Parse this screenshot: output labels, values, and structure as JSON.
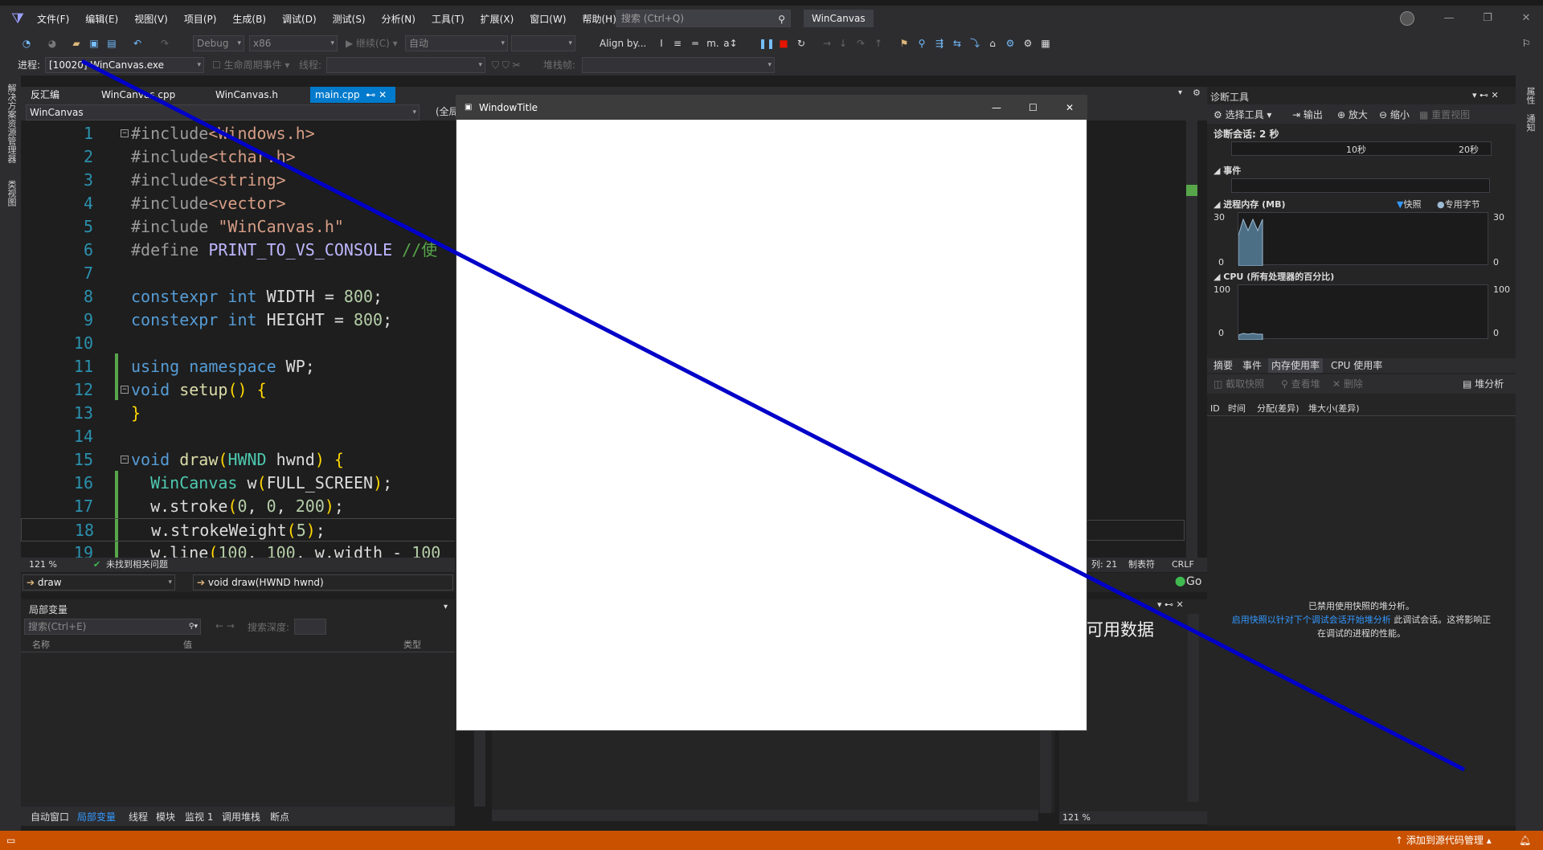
{
  "menubar": {
    "items": [
      "文件(F)",
      "编辑(E)",
      "视图(V)",
      "项目(P)",
      "生成(B)",
      "调试(D)",
      "测试(S)",
      "分析(N)",
      "工具(T)",
      "扩展(X)",
      "窗口(W)",
      "帮助(H)"
    ],
    "search_placeholder": "搜索 (Ctrl+Q)",
    "app_title": "WinCanvas"
  },
  "toolbar1": {
    "config": "Debug",
    "platform": "x86",
    "continue_label": "继续(C)",
    "auto_label": "自动",
    "align_label": "Align by..."
  },
  "toolbar2": {
    "process_label": "进程:",
    "process_value": "[10020] WinCanvas.exe",
    "lifecycle_label": "生命周期事件",
    "thread_label": "线程:",
    "stackframe_label": "堆栈帧:"
  },
  "tabs": {
    "disasm": "反汇编",
    "wincanvas_cpp": "WinCanvas.cpp",
    "wincanvas_h": "WinCanvas.h",
    "main_cpp": "main.cpp",
    "pin": "⊷",
    "close": "✕"
  },
  "navbar": {
    "project": "WinCanvas",
    "scope": "(全局"
  },
  "editor": {
    "zoom": "121 %",
    "issues": "未找到相关问题",
    "col": "列: 21",
    "tab_mode": "制表符",
    "eol": "CRLF",
    "go_label": "Go",
    "lines": [
      "1",
      "2",
      "3",
      "4",
      "5",
      "6",
      "7",
      "8",
      "9",
      "10",
      "11",
      "12",
      "13",
      "14",
      "15",
      "16",
      "17",
      "18",
      "19"
    ]
  },
  "callbar": {
    "function_combo": "draw",
    "context": "void draw(HWND hwnd)"
  },
  "locals": {
    "title": "局部变量",
    "search_placeholder": "搜索(Ctrl+E)",
    "depth_label": "搜索深度:",
    "col_name": "名称",
    "col_value": "值",
    "col_type": "类型"
  },
  "bottom_tabs": [
    "自动窗口",
    "局部变量",
    "线程",
    "模块",
    "监视 1",
    "调用堆栈",
    "断点"
  ],
  "middle_panel": {
    "no_data": "可用数据",
    "zoom": "121 %"
  },
  "diagnostic": {
    "title": "诊断工具",
    "select_tool": "选择工具",
    "output": "输出",
    "zoom_in": "放大",
    "zoom_out": "缩小",
    "reset_view": "重置视图",
    "session": "诊断会话: 2 秒",
    "t10": "10秒",
    "t20": "20秒",
    "events": "事件",
    "memory_title": "进程内存 (MB)",
    "snapshot": "快照",
    "private_bytes": "专用字节",
    "mem_max": "30",
    "mem_min": "0",
    "cpu_title": "CPU (所有处理器的百分比)",
    "cpu_max": "100",
    "cpu_min": "0",
    "tab_summary": "摘要",
    "tab_events": "事件",
    "tab_memory": "内存使用率",
    "tab_cpu": "CPU 使用率",
    "take_snapshot": "截取快照",
    "view_heap": "查看堆",
    "delete": "删除",
    "heap_profiling": "堆分析",
    "col_id": "ID",
    "col_time": "时间",
    "col_alloc": "分配(差异)",
    "col_heapsize": "堆大小(差异)",
    "msg1": "已禁用使用快照的堆分析。",
    "msg_link": "启用快照以针对下个调试会话开始堆分析",
    "msg2": " 此调试会话。这将影响正",
    "msg3": "在调试的进程的性能。"
  },
  "left_rail": {
    "solution": "解决方案资源管理器",
    "classview": "类视图"
  },
  "right_rail": {
    "props": "属性",
    "notify": "通知"
  },
  "app_window": {
    "title": "WindowTitle",
    "minimize": "—",
    "maximize": "☐",
    "close": "✕"
  },
  "statusbar": {
    "source_control": "添加到源代码管理"
  },
  "colors": {
    "accent": "#007acc",
    "statusbar": "#ca5100",
    "drawn_line": "#0000c8"
  }
}
